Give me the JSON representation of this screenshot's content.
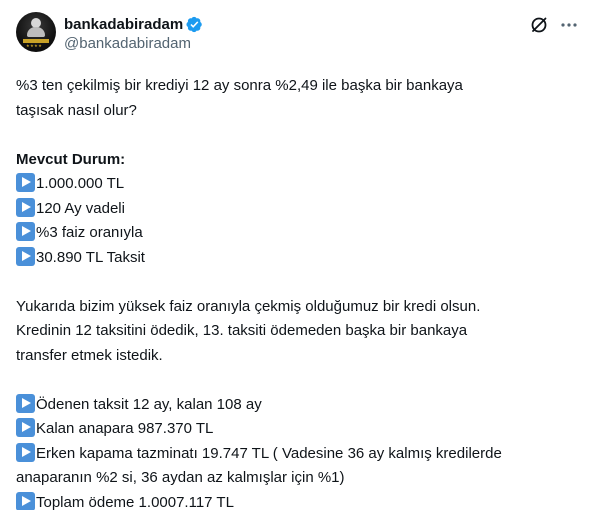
{
  "author": {
    "display_name": "bankadabiradam",
    "handle": "@bankadabiradam",
    "verified": true,
    "avatar_icon": "profile-avatar-icon",
    "verified_icon": "verified-badge-icon",
    "verified_color": "#1d9bf0"
  },
  "header_actions": {
    "grok_icon": "grok-icon",
    "more_icon": "more-options-icon"
  },
  "tweet": {
    "intro_1": "%3 ten çekilmiş bir krediyi 12 ay sonra %2,49 ile başka bir bankaya",
    "intro_2": "taşısak nasıl olur?",
    "section_title": "Mevcut Durum:",
    "current": [
      "1.000.000 TL",
      "120 Ay vadeli",
      "%3 faiz oranıyla",
      "30.890 TL Taksit"
    ],
    "para_1": "Yukarıda bizim yüksek faiz oranıyla çekmiş olduğumuz bir kredi olsun.",
    "para_2": "Kredinin 12 taksitini ödedik, 13. taksiti ödemeden başka bir bankaya",
    "para_3": "transfer etmek istedik.",
    "details": [
      "Ödenen taksit 12 ay, kalan 108 ay",
      "Kalan anapara 987.370 TL",
      "Erken kapama tazminatı 19.747 TL ( Vadesine 36 ay kalmış kredilerde",
      "anaparanın %2 si, 36 aydan az kalmışlar için %1)",
      "Toplam ödeme 1.0007.117 TL"
    ],
    "bullet_icon": "play-button-emoji-icon",
    "bullet_color": "#4a90d9"
  }
}
